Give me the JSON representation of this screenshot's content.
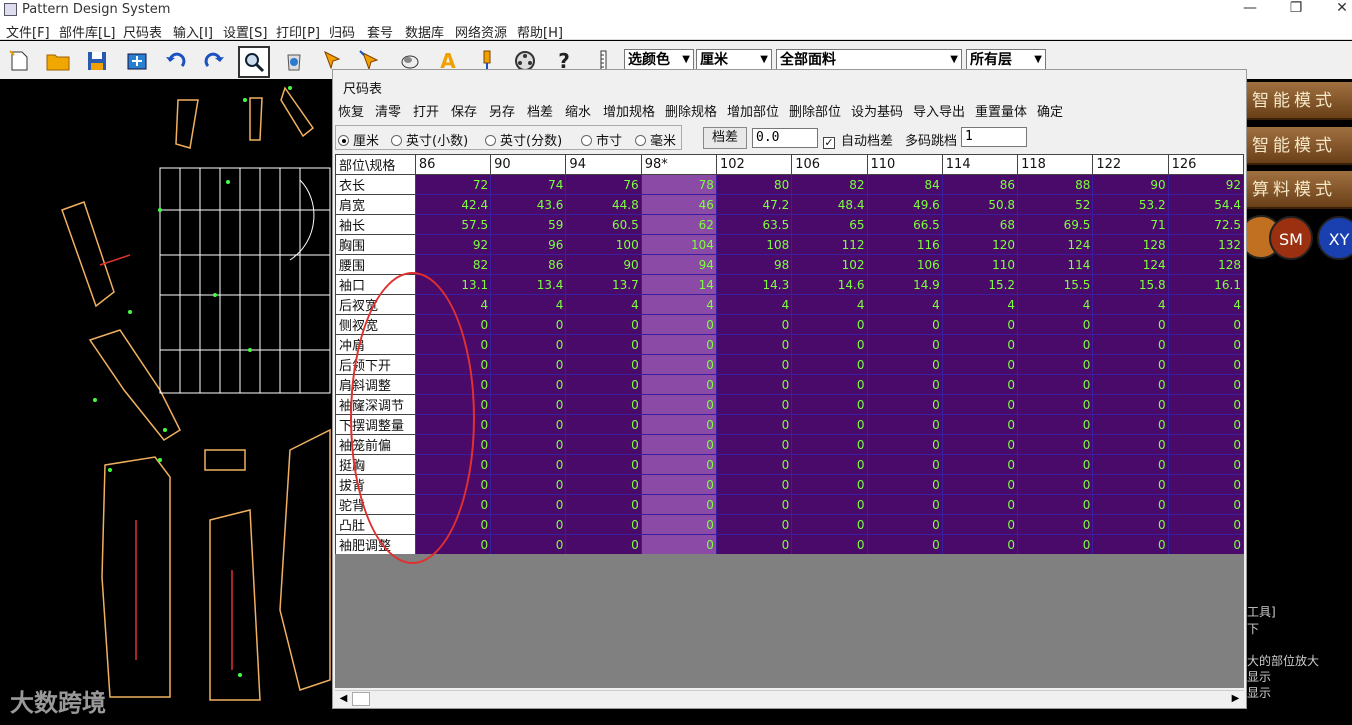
{
  "app": {
    "title": "Pattern Design System",
    "minimize": "—",
    "restore": "❐",
    "close": "✕"
  },
  "menu": [
    "文件[F]",
    "部件库[L]",
    "尺码表",
    "输入[I]",
    "设置[S]",
    "打印[P]",
    "归码",
    "套号",
    "数据库",
    "网络资源",
    "帮助[H]"
  ],
  "toolbar": {
    "icons": [
      "new-file",
      "open-folder",
      "save-disk",
      "image-insert",
      "undo",
      "redo",
      "zoom-magnifier",
      "delete-bin",
      "arrow-pointer",
      "arrow-pointer-alt",
      "eraser",
      "text-A",
      "pin",
      "film-reel",
      "help-question",
      "ruler"
    ],
    "color_select": "选颜色",
    "unit_select": "厘米",
    "fabric_select": "全部面料",
    "layer_select": "所有层",
    "help": "?",
    "text_tool": "A"
  },
  "right_panel": {
    "modes": [
      "智能模式",
      "智能模式",
      "算料模式"
    ],
    "sm": "SM",
    "xy": "XY",
    "texts": [
      "工具]",
      "下",
      "大的部位放大",
      "显示",
      "显示"
    ]
  },
  "dialog": {
    "title": "尺码表",
    "menu": [
      "恢复",
      "清零",
      "打开",
      "保存",
      "另存",
      "档差",
      "缩水",
      "增加规格",
      "删除规格",
      "增加部位",
      "删除部位",
      "设为基码",
      "导入导出",
      "重置量体",
      "确定"
    ],
    "units": [
      {
        "label": "厘米",
        "checked": true
      },
      {
        "label": "英寸(小数)",
        "checked": false
      },
      {
        "label": "英寸(分数)",
        "checked": false
      },
      {
        "label": "市寸",
        "checked": false
      },
      {
        "label": "毫米",
        "checked": false
      }
    ],
    "grade_button": "档差",
    "grade_value": "0.0",
    "auto_grade_label": "自动档差",
    "auto_grade_checked": "✓",
    "multi_skip_label": "多码跳档",
    "multi_skip_value": "1",
    "table": {
      "corner": "部位\\规格",
      "sizes": [
        "86",
        "90",
        "94",
        "98*",
        "102",
        "106",
        "110",
        "114",
        "118",
        "122",
        "126"
      ],
      "selected_col": 3,
      "rows": [
        {
          "name": "衣长",
          "values": [
            "72",
            "74",
            "76",
            "78",
            "80",
            "82",
            "84",
            "86",
            "88",
            "90",
            "92"
          ]
        },
        {
          "name": "肩宽",
          "values": [
            "42.4",
            "43.6",
            "44.8",
            "46",
            "47.2",
            "48.4",
            "49.6",
            "50.8",
            "52",
            "53.2",
            "54.4"
          ]
        },
        {
          "name": "袖长",
          "values": [
            "57.5",
            "59",
            "60.5",
            "62",
            "63.5",
            "65",
            "66.5",
            "68",
            "69.5",
            "71",
            "72.5"
          ]
        },
        {
          "name": "胸围",
          "values": [
            "92",
            "96",
            "100",
            "104",
            "108",
            "112",
            "116",
            "120",
            "124",
            "128",
            "132"
          ]
        },
        {
          "name": "腰围",
          "values": [
            "82",
            "86",
            "90",
            "94",
            "98",
            "102",
            "106",
            "110",
            "114",
            "124",
            "128"
          ]
        },
        {
          "name": "袖口",
          "values": [
            "13.1",
            "13.4",
            "13.7",
            "14",
            "14.3",
            "14.6",
            "14.9",
            "15.2",
            "15.5",
            "15.8",
            "16.1"
          ]
        },
        {
          "name": "后衩宽",
          "values": [
            "4",
            "4",
            "4",
            "4",
            "4",
            "4",
            "4",
            "4",
            "4",
            "4",
            "4"
          ]
        },
        {
          "name": "侧衩宽",
          "values": [
            "0",
            "0",
            "0",
            "0",
            "0",
            "0",
            "0",
            "0",
            "0",
            "0",
            "0"
          ]
        },
        {
          "name": "冲肩",
          "values": [
            "0",
            "0",
            "0",
            "0",
            "0",
            "0",
            "0",
            "0",
            "0",
            "0",
            "0"
          ]
        },
        {
          "name": "后领下开",
          "values": [
            "0",
            "0",
            "0",
            "0",
            "0",
            "0",
            "0",
            "0",
            "0",
            "0",
            "0"
          ]
        },
        {
          "name": "肩斜调整",
          "values": [
            "0",
            "0",
            "0",
            "0",
            "0",
            "0",
            "0",
            "0",
            "0",
            "0",
            "0"
          ]
        },
        {
          "name": "袖窿深调节",
          "values": [
            "0",
            "0",
            "0",
            "0",
            "0",
            "0",
            "0",
            "0",
            "0",
            "0",
            "0"
          ]
        },
        {
          "name": "下摆调整量",
          "values": [
            "0",
            "0",
            "0",
            "0",
            "0",
            "0",
            "0",
            "0",
            "0",
            "0",
            "0"
          ]
        },
        {
          "name": "袖笼前偏",
          "values": [
            "0",
            "0",
            "0",
            "0",
            "0",
            "0",
            "0",
            "0",
            "0",
            "0",
            "0"
          ]
        },
        {
          "name": "挺胸",
          "values": [
            "0",
            "0",
            "0",
            "0",
            "0",
            "0",
            "0",
            "0",
            "0",
            "0",
            "0"
          ]
        },
        {
          "name": "拔背",
          "values": [
            "0",
            "0",
            "0",
            "0",
            "0",
            "0",
            "0",
            "0",
            "0",
            "0",
            "0"
          ]
        },
        {
          "name": "驼背",
          "values": [
            "0",
            "0",
            "0",
            "0",
            "0",
            "0",
            "0",
            "0",
            "0",
            "0",
            "0"
          ]
        },
        {
          "name": "凸肚",
          "values": [
            "0",
            "0",
            "0",
            "0",
            "0",
            "0",
            "0",
            "0",
            "0",
            "0",
            "0"
          ]
        },
        {
          "name": "袖肥调整",
          "values": [
            "0",
            "0",
            "0",
            "0",
            "0",
            "0",
            "0",
            "0",
            "0",
            "0",
            "0"
          ]
        }
      ]
    }
  },
  "watermark": "大数跨境",
  "colors": {
    "grid_bg": "#4a0a6a",
    "grid_text": "#7cff3c",
    "selected_col": "#8a4aa6",
    "annotation": "#e03030",
    "pattern_line": "#f0b060"
  }
}
